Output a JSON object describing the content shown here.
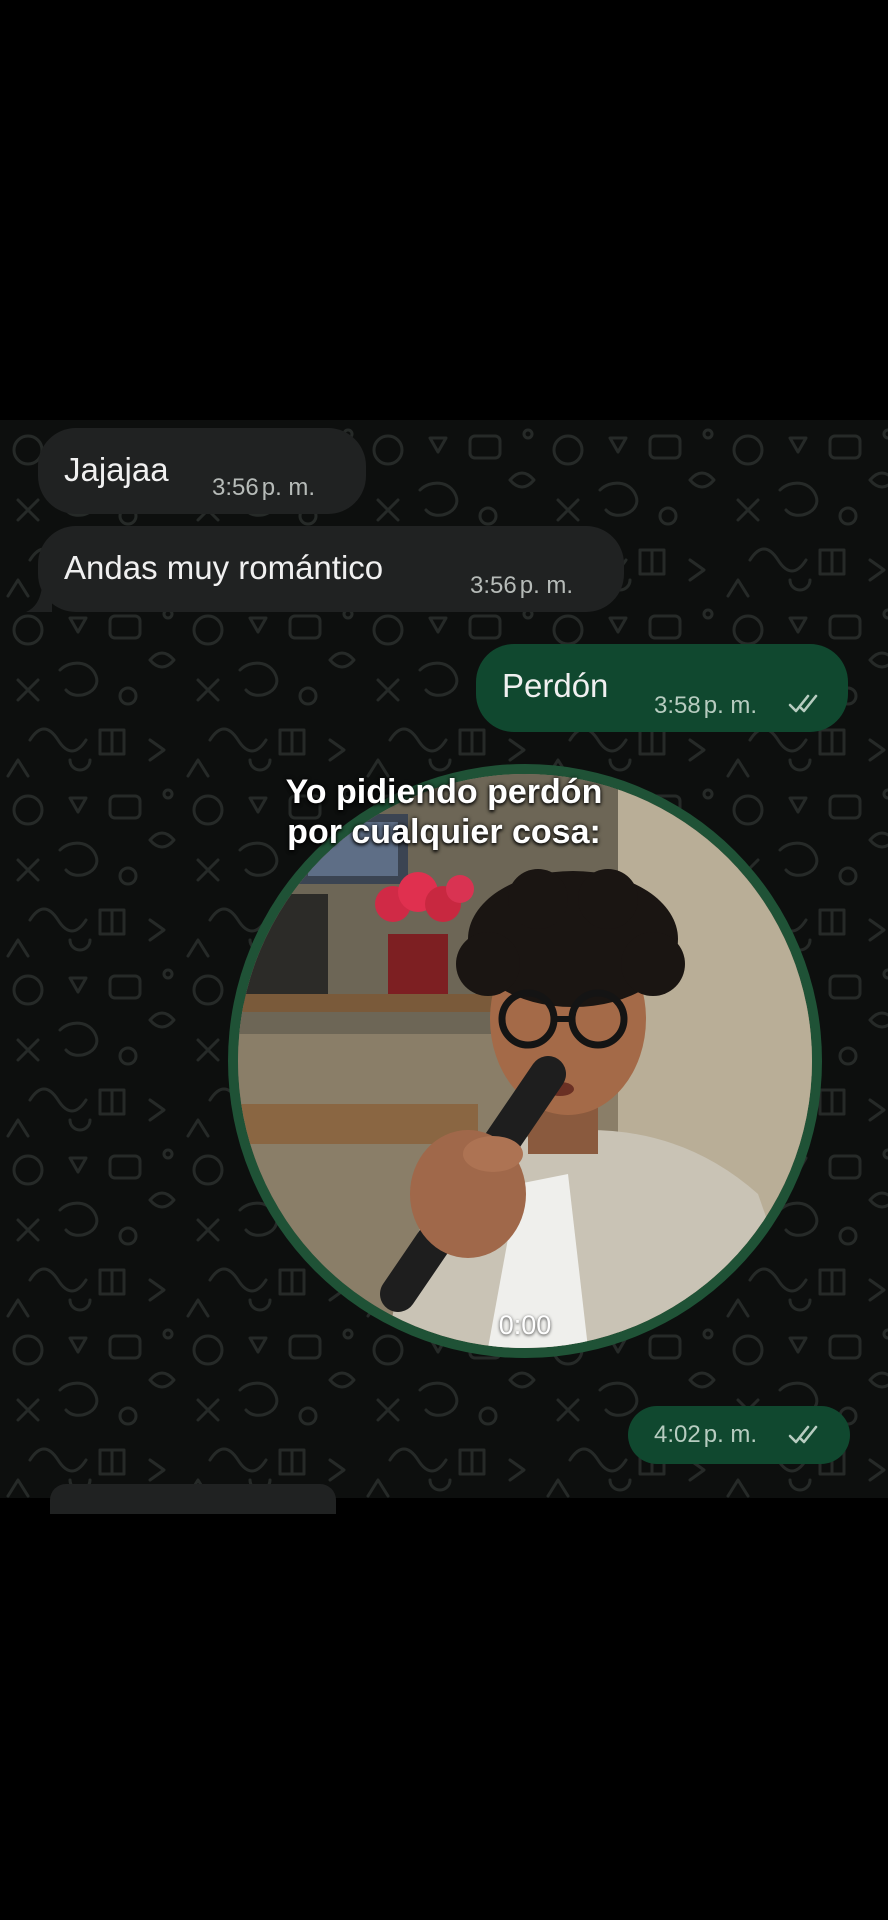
{
  "messages": [
    {
      "direction": "incoming",
      "text": "Jajajaa",
      "time": "3:56",
      "suffix": "p. m."
    },
    {
      "direction": "incoming",
      "text": "Andas muy romántico",
      "time": "3:56",
      "suffix": "p. m."
    },
    {
      "direction": "outgoing",
      "text": "Perdón",
      "time": "3:58",
      "suffix": "p. m.",
      "status": "read"
    }
  ],
  "overlay_caption": {
    "line1": "Yo pidiendo perdón",
    "line2": "por cualquier cosa:"
  },
  "video_note": {
    "duration": "0:00",
    "time": "4:02",
    "suffix": "p. m.",
    "status": "read"
  },
  "colors": {
    "incoming_bubble": "#202222",
    "outgoing_bubble": "#10482f",
    "video_ring": "#1f5236",
    "chat_background": "#0d0f0e"
  },
  "icons": {
    "read_receipt": "double-check-icon"
  }
}
